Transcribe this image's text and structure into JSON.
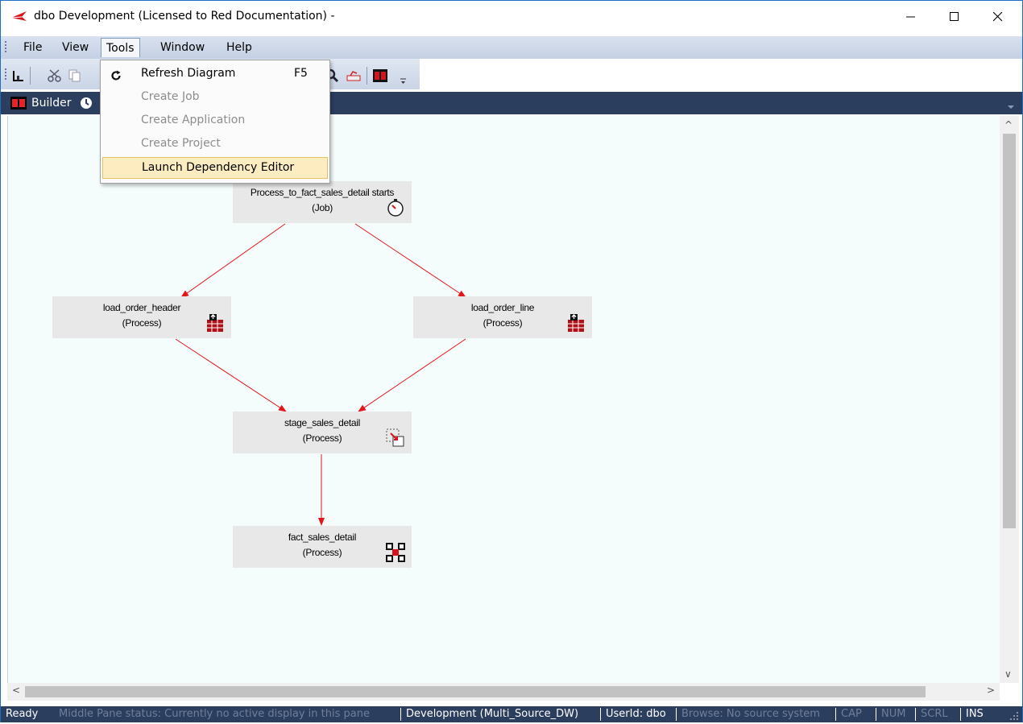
{
  "window": {
    "title": "dbo  Development  (Licensed to Red Documentation) -"
  },
  "menubar": {
    "items": [
      "File",
      "View",
      "Tools",
      "Window",
      "Help"
    ],
    "active": "Tools"
  },
  "tools_menu": {
    "items": [
      {
        "label": "Refresh Diagram",
        "shortcut": "F5",
        "enabled": true,
        "icon": "refresh-icon"
      },
      {
        "label": "Create Job",
        "enabled": false
      },
      {
        "label": "Create Application",
        "enabled": false
      },
      {
        "label": "Create Project",
        "enabled": false
      },
      {
        "label": "Launch Dependency Editor",
        "enabled": true,
        "highlighted": true
      }
    ]
  },
  "tabs": [
    {
      "label": "Builder",
      "icon": "builder-icon"
    },
    {
      "label": "",
      "icon": "clock-icon"
    }
  ],
  "diagram": {
    "nodes": [
      {
        "name": "Process_to_fact_sales_detail starts",
        "type": "(Job)",
        "icon": "stopwatch-icon"
      },
      {
        "name": "load_order_header",
        "type": "(Process)",
        "icon": "load-table-icon"
      },
      {
        "name": "load_order_line",
        "type": "(Process)",
        "icon": "load-table-icon"
      },
      {
        "name": "stage_sales_detail",
        "type": "(Process)",
        "icon": "stage-table-icon"
      },
      {
        "name": "fact_sales_detail",
        "type": "(Process)",
        "icon": "fact-table-icon"
      }
    ],
    "edge_color": "#e8141c"
  },
  "statusbar": {
    "ready": "Ready",
    "middle_pane": "Middle Pane status: Currently no active display in this pane",
    "connection": "Development (Multi_Source_DW)",
    "user": "UserId: dbo",
    "browse": "Browse: No source system",
    "cap": "CAP",
    "num": "NUM",
    "scrl": "SCRL",
    "ins": "INS"
  }
}
